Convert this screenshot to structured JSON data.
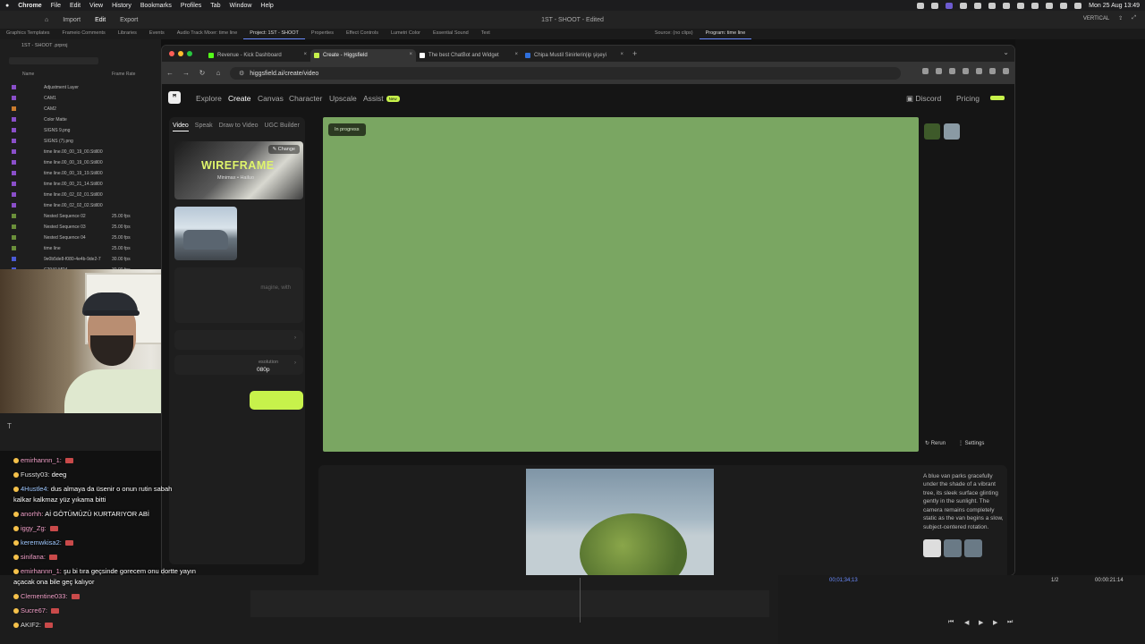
{
  "menubar": {
    "app": "Chrome",
    "items": [
      "File",
      "Edit",
      "View",
      "History",
      "Bookmarks",
      "Profiles",
      "Tab",
      "Window",
      "Help"
    ],
    "datetime": "Mon 25 Aug  13:49"
  },
  "premiere": {
    "top_items": [
      "Import",
      "Edit",
      "Export"
    ],
    "title": "1ST - SHOOT - Edited",
    "workspace": "VERTICAL",
    "panel_tabs": [
      "Graphics Templates",
      "Frameio Comments",
      "Libraries",
      "Events",
      "Audio Track Mixer: time line",
      "Project: 1ST - SHOOT",
      "Properties",
      "Effect Controls",
      "Lumetri Color",
      "Essential Sound",
      "Text",
      "Source: (no clips)",
      "Program: time line"
    ],
    "project_file": "1ST - SHOOT .prproj",
    "col_name": "Name",
    "col_frame_rate": "Frame Rate",
    "items": [
      {
        "name": "Adjustment Layer",
        "rate": "",
        "color": "#8a4fc9"
      },
      {
        "name": "CAM1",
        "rate": "",
        "color": "#8a4fc9"
      },
      {
        "name": "CAM2",
        "rate": "",
        "color": "#c97b2e"
      },
      {
        "name": "Color Matte",
        "rate": "",
        "color": "#8a4fc9"
      },
      {
        "name": "SIGNS 9.png",
        "rate": "",
        "color": "#8a4fc9"
      },
      {
        "name": "SIGNS (7).png",
        "rate": "",
        "color": "#8a4fc9"
      },
      {
        "name": "time line.00_00_19_00.Still00",
        "rate": "",
        "color": "#8a4fc9"
      },
      {
        "name": "time line.00_00_19_00.Still00",
        "rate": "",
        "color": "#8a4fc9"
      },
      {
        "name": "time line.00_00_19_19.Still00",
        "rate": "",
        "color": "#8a4fc9"
      },
      {
        "name": "time line.00_00_21_14.Still00",
        "rate": "",
        "color": "#8a4fc9"
      },
      {
        "name": "time line.00_02_02_01.Still00",
        "rate": "",
        "color": "#8a4fc9"
      },
      {
        "name": "time line.00_02_02_02.Still00",
        "rate": "",
        "color": "#8a4fc9"
      },
      {
        "name": "Nested Sequence 02",
        "rate": "25.00 fps",
        "color": "#6a8f3a"
      },
      {
        "name": "Nested Sequence 03",
        "rate": "25.00 fps",
        "color": "#6a8f3a"
      },
      {
        "name": "Nested Sequence 04",
        "rate": "25.00 fps",
        "color": "#6a8f3a"
      },
      {
        "name": "time line",
        "rate": "25.00 fps",
        "color": "#6a8f3a"
      },
      {
        "name": "9e0b5de8-f080-4e4b-9de2-7",
        "rate": "30.00 fps",
        "color": "#4b5bd6"
      },
      {
        "name": "C2940.MP4",
        "rate": "30.00 fps",
        "color": "#4b5bd6"
      }
    ],
    "source_timecode": "00;01;34;13",
    "program_timecode": "00:00:21:14",
    "zoom": "1/2"
  },
  "chat": [
    {
      "user": "emirhannn_1:",
      "text": "",
      "color": "pink"
    },
    {
      "user": "Fussty03:",
      "text": "deeg",
      "color": "white"
    },
    {
      "user": "4Hustle4:",
      "text": "dus almaya da üsenir o onun rutin sabah",
      "color": "blue"
    },
    {
      "user": "",
      "text": "kalkar kalkmaz yüz yıkama bitti",
      "color": "white"
    },
    {
      "user": "anorhh:",
      "text": "Aİ GÖTÜMÜZÜ KURTARIYOR ABİ",
      "color": "pink"
    },
    {
      "user": "iggy_Zg:",
      "text": "",
      "color": "pink"
    },
    {
      "user": "keremwkisa2:",
      "text": "",
      "color": "blue"
    },
    {
      "user": "sinifana:",
      "text": "",
      "color": "pink"
    },
    {
      "user": "emirhannn_1:",
      "text": "şu bi tıra geçsinde gorecem onu dortte yayın",
      "color": "pink"
    },
    {
      "user": "",
      "text": "açacak ona bile geç kalıyor",
      "color": "white"
    },
    {
      "user": "Clementine033:",
      "text": "",
      "color": "pink"
    },
    {
      "user": "Sucre67:",
      "text": "",
      "color": "pink"
    },
    {
      "user": "AKIF2:",
      "text": "",
      "color": "white"
    }
  ],
  "browser": {
    "tabs": [
      {
        "title": "Revenue - Kick Dashboard",
        "color": "#53fc18",
        "active": false
      },
      {
        "title": "Create - Higgsfield",
        "color": "#c7f24b",
        "active": true
      },
      {
        "title": "The best ChatBot and Widget",
        "color": "#ffffff",
        "active": false
      },
      {
        "title": "Chipa Mustil Sinirlerin|ip şişeyi",
        "color": "#2f6fdb",
        "active": false
      }
    ],
    "url": "higgsfield.ai/create/video"
  },
  "site": {
    "nav": [
      "Explore",
      "Create",
      "Canvas",
      "Character",
      "Upscale",
      "Assist"
    ],
    "nav_active": "Create",
    "new_badge": "New",
    "discord": "Discord",
    "pricing": "Pricing",
    "left_tabs": [
      "Video",
      "Speak",
      "Draw to Video",
      "UGC Builder"
    ],
    "preset_title": "WIREFRAME",
    "preset_sub": "Minimax • Hailuo",
    "change": "Change",
    "prompt_placeholder": "magine, with",
    "resolution_label": "esolution",
    "resolution_value": "080p",
    "status": "In progress",
    "rerun": "Rerun",
    "settings": "Settings",
    "description": "A blue van parks gracefully under the shade of a vibrant tree, its sleek surface glinting gently in the sunlight. The camera remains completely static as the van begins a slow, subject-centered rotation.",
    "preview_color": "#7aa662",
    "accent": "#c7f24b"
  }
}
